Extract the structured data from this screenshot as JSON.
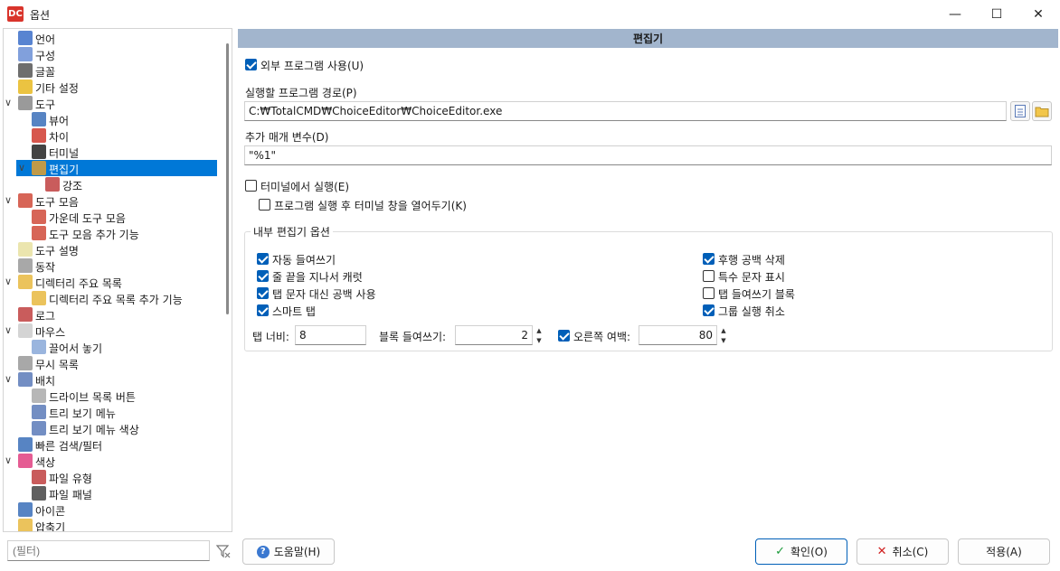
{
  "window": {
    "title": "옵션",
    "app_icon_text": "DC",
    "minimize_glyph": "—",
    "maximize_glyph": "☐",
    "close_glyph": "✕"
  },
  "sidebar": {
    "items": [
      {
        "label": "언어",
        "level": 0,
        "expander": "",
        "icon_color": "#3b6fc9",
        "selected": false
      },
      {
        "label": "구성",
        "level": 0,
        "expander": "",
        "icon_color": "#6b8fd6",
        "selected": false
      },
      {
        "label": "글꼴",
        "level": 0,
        "expander": "",
        "icon_color": "#555555",
        "selected": false
      },
      {
        "label": "기타 설정",
        "level": 0,
        "expander": "",
        "icon_color": "#e8b820",
        "selected": false
      },
      {
        "label": "도구",
        "level": 0,
        "expander": "∨",
        "icon_color": "#888888",
        "selected": false
      },
      {
        "label": "뷰어",
        "level": 1,
        "expander": "",
        "icon_color": "#3a6fb8",
        "selected": false
      },
      {
        "label": "차이",
        "level": 1,
        "expander": "",
        "icon_color": "#d03a2e",
        "selected": false
      },
      {
        "label": "터미널",
        "level": 1,
        "expander": "",
        "icon_color": "#222222",
        "selected": false
      },
      {
        "label": "편집기",
        "level": 1,
        "expander": "∨",
        "icon_color": "#e0a030",
        "selected": true
      },
      {
        "label": "강조",
        "level": 2,
        "expander": "",
        "icon_color": "#c04040",
        "selected": false
      },
      {
        "label": "도구 모음",
        "level": 0,
        "expander": "∨",
        "icon_color": "#d04a3a",
        "selected": false
      },
      {
        "label": "가운데 도구 모음",
        "level": 1,
        "expander": "",
        "icon_color": "#d04a3a",
        "selected": false
      },
      {
        "label": "도구 모음 추가 기능",
        "level": 1,
        "expander": "",
        "icon_color": "#d04a3a",
        "selected": false
      },
      {
        "label": "도구 설명",
        "level": 0,
        "expander": "",
        "icon_color": "#e8e0a0",
        "selected": false
      },
      {
        "label": "동작",
        "level": 0,
        "expander": "",
        "icon_color": "#999999",
        "selected": false
      },
      {
        "label": "디렉터리 주요 목록",
        "level": 0,
        "expander": "∨",
        "icon_color": "#e8b840",
        "selected": false
      },
      {
        "label": "디렉터리 주요 목록 추가 기능",
        "level": 1,
        "expander": "",
        "icon_color": "#e8b840",
        "selected": false
      },
      {
        "label": "로그",
        "level": 0,
        "expander": "",
        "icon_color": "#c04040",
        "selected": false
      },
      {
        "label": "마우스",
        "level": 0,
        "expander": "∨",
        "icon_color": "#cccccc",
        "selected": false
      },
      {
        "label": "끌어서 놓기",
        "level": 1,
        "expander": "",
        "icon_color": "#88a8d8",
        "selected": false
      },
      {
        "label": "무시 목록",
        "level": 0,
        "expander": "",
        "icon_color": "#999999",
        "selected": false
      },
      {
        "label": "배치",
        "level": 0,
        "expander": "∨",
        "icon_color": "#5a7ab8",
        "selected": false
      },
      {
        "label": "드라이브 목록 버튼",
        "level": 1,
        "expander": "",
        "icon_color": "#aaaaaa",
        "selected": false
      },
      {
        "label": "트리 보기 메뉴",
        "level": 1,
        "expander": "",
        "icon_color": "#5a7ab8",
        "selected": false
      },
      {
        "label": "트리 보기 메뉴 색상",
        "level": 1,
        "expander": "",
        "icon_color": "#5a7ab8",
        "selected": false
      },
      {
        "label": "빠른 검색/필터",
        "level": 0,
        "expander": "",
        "icon_color": "#3a6fb8",
        "selected": false
      },
      {
        "label": "색상",
        "level": 0,
        "expander": "∨",
        "icon_color": "#e04080",
        "selected": false
      },
      {
        "label": "파일 유형",
        "level": 1,
        "expander": "",
        "icon_color": "#c04040",
        "selected": false
      },
      {
        "label": "파일 패널",
        "level": 1,
        "expander": "",
        "icon_color": "#444444",
        "selected": false
      },
      {
        "label": "아이콘",
        "level": 0,
        "expander": "",
        "icon_color": "#3a6fb8",
        "selected": false
      },
      {
        "label": "압축기",
        "level": 0,
        "expander": "",
        "icon_color": "#e8b840",
        "selected": false
      }
    ],
    "filter_placeholder": "(필터)"
  },
  "panel": {
    "header": "편집기",
    "use_external": {
      "label": "외부 프로그램 사용(U)",
      "checked": true
    },
    "path_label": "실행할 프로그램 경로(P)",
    "path_value": "C:₩TotalCMD₩ChoiceEditor₩ChoiceEditor.exe",
    "params_label": "추가 매개 변수(D)",
    "params_value": "\"%1\"",
    "run_in_terminal": {
      "label": "터미널에서 실행(E)",
      "checked": false
    },
    "keep_terminal": {
      "label": "프로그램 실행 후 터미널 창을 열어두기(K)",
      "checked": false
    },
    "internal_group": {
      "title": "내부 편집기 옵션",
      "left_options": [
        {
          "label": "자동 들여쓰기",
          "checked": true
        },
        {
          "label": "줄 끝을 지나서 캐럿",
          "checked": true
        },
        {
          "label": "탭 문자 대신 공백 사용",
          "checked": true
        },
        {
          "label": "스마트 탭",
          "checked": true
        }
      ],
      "right_options": [
        {
          "label": "후행 공백 삭제",
          "checked": true
        },
        {
          "label": "특수 문자 표시",
          "checked": false
        },
        {
          "label": "탭 들여쓰기 블록",
          "checked": false
        },
        {
          "label": "그룹 실행 취소",
          "checked": true
        }
      ],
      "tab_width_label": "탭 너비:",
      "tab_width_value": "8",
      "block_indent_label": "블록 들여쓰기:",
      "block_indent_value": "2",
      "right_margin": {
        "label": "오른쪽 여백:",
        "checked": true
      },
      "right_margin_value": "80"
    }
  },
  "buttons": {
    "help": "도움말(H)",
    "ok": "확인(O)",
    "cancel": "취소(C)",
    "apply": "적용(A)"
  }
}
